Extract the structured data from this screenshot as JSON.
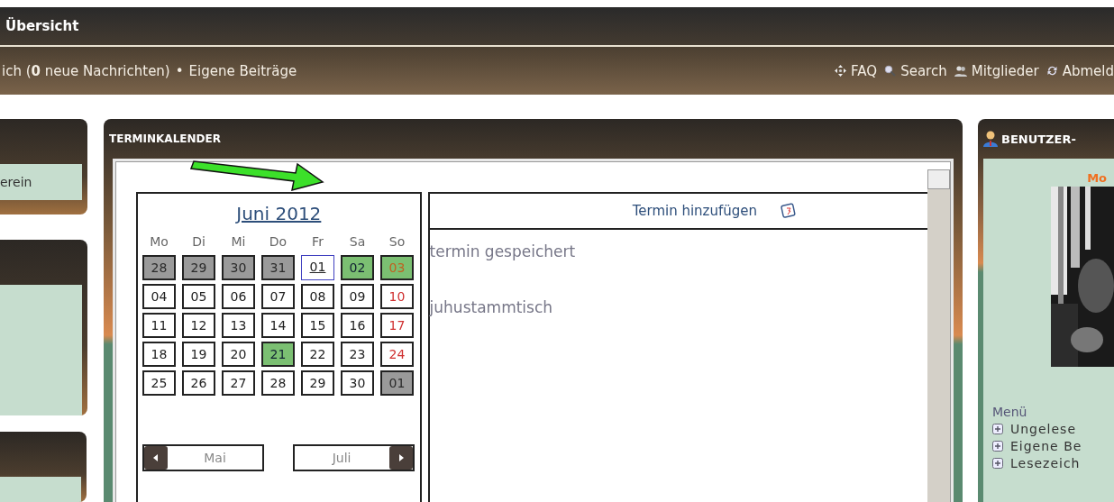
{
  "header": {
    "title": "Übersicht"
  },
  "nav_left": [
    {
      "text": "ich (**0** neue Nachrichten)"
    },
    {
      "text": "Eigene Beiträge"
    }
  ],
  "nav_separator": "•",
  "nav_right": [
    {
      "label": "FAQ",
      "kind": "faq"
    },
    {
      "label": "Search",
      "kind": "search"
    },
    {
      "label": "Mitglieder",
      "kind": "members"
    },
    {
      "label": "Abmeld",
      "kind": "logout"
    }
  ],
  "left_sidebar": {
    "link": "erein"
  },
  "calendar_panel": {
    "title": "TERMINKALENDER",
    "month_title": "Juni 2012",
    "weekdays": [
      "Mo",
      "Di",
      "Mi",
      "Do",
      "Fr",
      "Sa",
      "So"
    ],
    "weeks": [
      [
        {
          "day": "28",
          "kind": "other"
        },
        {
          "day": "29",
          "kind": "other"
        },
        {
          "day": "30",
          "kind": "other"
        },
        {
          "day": "31",
          "kind": "other"
        },
        {
          "day": "01",
          "kind": "today"
        },
        {
          "day": "02",
          "kind": "event"
        },
        {
          "day": "03",
          "kind": "event"
        }
      ],
      [
        {
          "day": "04",
          "kind": "normal"
        },
        {
          "day": "05",
          "kind": "normal"
        },
        {
          "day": "06",
          "kind": "normal"
        },
        {
          "day": "07",
          "kind": "normal"
        },
        {
          "day": "08",
          "kind": "normal"
        },
        {
          "day": "09",
          "kind": "normal"
        },
        {
          "day": "10",
          "kind": "normal"
        }
      ],
      [
        {
          "day": "11",
          "kind": "normal"
        },
        {
          "day": "12",
          "kind": "normal"
        },
        {
          "day": "13",
          "kind": "normal"
        },
        {
          "day": "14",
          "kind": "normal"
        },
        {
          "day": "15",
          "kind": "normal"
        },
        {
          "day": "16",
          "kind": "normal"
        },
        {
          "day": "17",
          "kind": "normal"
        }
      ],
      [
        {
          "day": "18",
          "kind": "normal"
        },
        {
          "day": "19",
          "kind": "normal"
        },
        {
          "day": "20",
          "kind": "normal"
        },
        {
          "day": "21",
          "kind": "event"
        },
        {
          "day": "22",
          "kind": "normal"
        },
        {
          "day": "23",
          "kind": "normal"
        },
        {
          "day": "24",
          "kind": "normal"
        }
      ],
      [
        {
          "day": "25",
          "kind": "normal"
        },
        {
          "day": "26",
          "kind": "normal"
        },
        {
          "day": "27",
          "kind": "normal"
        },
        {
          "day": "28",
          "kind": "normal"
        },
        {
          "day": "29",
          "kind": "normal"
        },
        {
          "day": "30",
          "kind": "normal"
        },
        {
          "day": "01",
          "kind": "other"
        }
      ]
    ],
    "prev_month": "Mai",
    "next_month": "Juli",
    "add_event": "Termin hinzufügen",
    "events": [
      "termin gespeichert",
      "juhustammtisch"
    ]
  },
  "user_panel": {
    "title": "BENUTZER-",
    "name": "Mo",
    "menu_title": "Menü",
    "menu": [
      "Ungelese",
      "Eigene Be",
      "Lesezeich"
    ]
  }
}
